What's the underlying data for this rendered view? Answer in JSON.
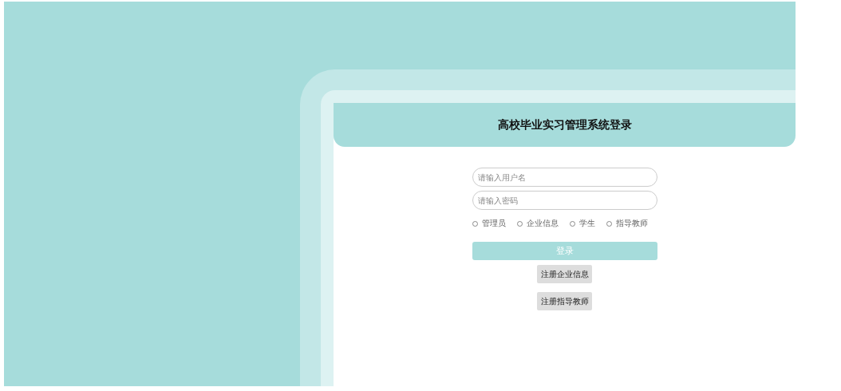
{
  "title": "高校毕业实习管理系统登录",
  "username": {
    "placeholder": "请输入用户名"
  },
  "password": {
    "placeholder": "请输入密码"
  },
  "roles": [
    {
      "label": "管理员",
      "selected": false
    },
    {
      "label": "企业信息",
      "selected": false
    },
    {
      "label": "学生",
      "selected": false
    },
    {
      "label": "指导教师",
      "selected": false
    }
  ],
  "login_button": "登录",
  "register_buttons": [
    "注册企业信息",
    "注册指导教师"
  ]
}
